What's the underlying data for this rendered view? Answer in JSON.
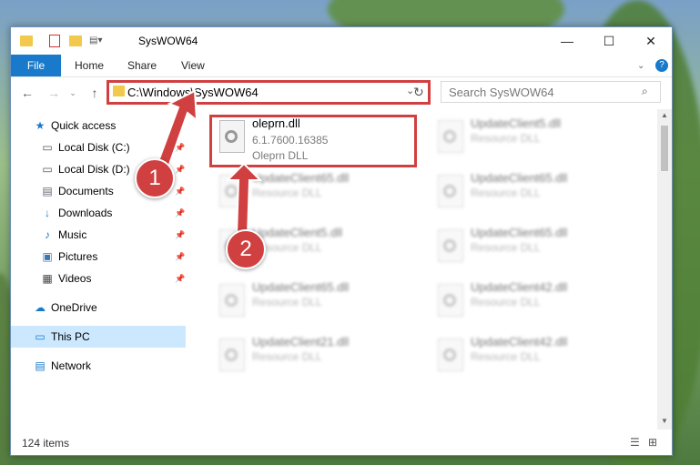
{
  "window": {
    "title": "SysWOW64"
  },
  "ribbon": {
    "file": "File",
    "tabs": [
      "Home",
      "Share",
      "View"
    ]
  },
  "nav": {
    "address": "C:\\Windows\\SysWOW64",
    "search_placeholder": "Search SysWOW64"
  },
  "sidebar": {
    "items": [
      {
        "label": "Quick access",
        "icon": "star-icon"
      },
      {
        "label": "Local Disk (C:)",
        "icon": "drive-icon"
      },
      {
        "label": "Local Disk (D:)",
        "icon": "drive-icon"
      },
      {
        "label": "Documents",
        "icon": "documents-icon"
      },
      {
        "label": "Downloads",
        "icon": "download-icon"
      },
      {
        "label": "Music",
        "icon": "music-icon"
      },
      {
        "label": "Pictures",
        "icon": "pictures-icon"
      },
      {
        "label": "Videos",
        "icon": "videos-icon"
      },
      {
        "label": "OneDrive",
        "icon": "cloud-icon"
      },
      {
        "label": "This PC",
        "icon": "pc-icon"
      },
      {
        "label": "Network",
        "icon": "network-icon"
      }
    ]
  },
  "files": [
    {
      "name": "oleprn.dll",
      "line2": "6.1.7600.16385",
      "line3": "Oleprn DLL"
    },
    {
      "name": "UpdateClient5.dll",
      "line2": "Resource DLL"
    },
    {
      "name": "UpdateClient65.dll",
      "line2": "Resource DLL"
    },
    {
      "name": "UpdateClient65.dll",
      "line2": "Resource DLL"
    },
    {
      "name": "UpdateClient5.dll",
      "line2": "Resource DLL"
    },
    {
      "name": "UpdateClient65.dll",
      "line2": "Resource DLL"
    },
    {
      "name": "UpdateClient65.dll",
      "line2": "Resource DLL"
    },
    {
      "name": "UpdateClient42.dll",
      "line2": "Resource DLL"
    },
    {
      "name": "UpdateClient21.dll",
      "line2": "Resource DLL"
    },
    {
      "name": "UpdateClient42.dll",
      "line2": "Resource DLL"
    }
  ],
  "status": {
    "count": "124 items"
  },
  "annotations": {
    "step1": "1",
    "step2": "2"
  },
  "colors": {
    "accent": "#1979ca",
    "highlight": "#d04040",
    "selected": "#cce8ff"
  }
}
